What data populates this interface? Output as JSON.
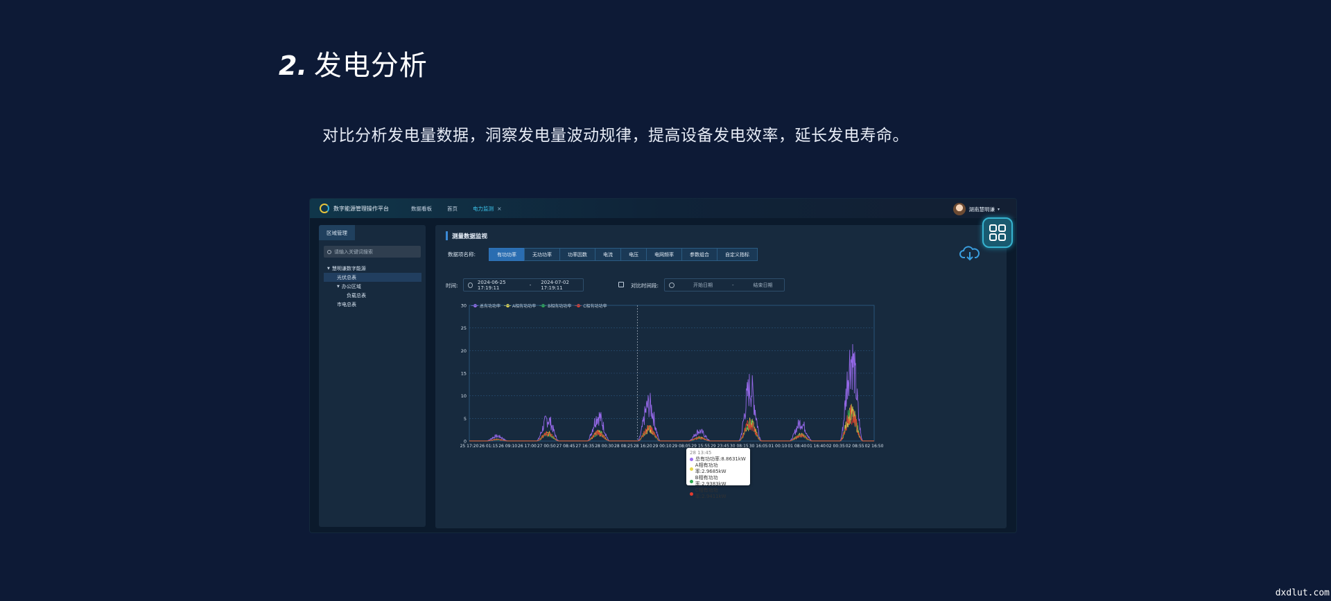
{
  "slide": {
    "number": "2.",
    "title": "发电分析",
    "description": "对比分析发电量数据，洞察发电量波动规律，提高设备发电效率，延长发电寿命。",
    "watermark": "dxdlut.com"
  },
  "app": {
    "brand": "数字能源管理操作平台",
    "nav": [
      "数据看板",
      "首页",
      "电力监测"
    ],
    "active_tab_close": "×",
    "user": "湖南慧明谦",
    "colors": {
      "accent": "#2a6db1",
      "highlight": "#3ec8f0",
      "background": "#0d1a36"
    }
  },
  "sidebar": {
    "tab": "区域管理",
    "search_placeholder": "请输入关键词搜索",
    "tree": [
      {
        "label": "慧明谦数字能源",
        "level": 1,
        "expanded": true
      },
      {
        "label": "光伏总表",
        "level": 2,
        "selected": true
      },
      {
        "label": "办公区域",
        "level": 2,
        "expanded": true
      },
      {
        "label": "负载总表",
        "level": 3
      },
      {
        "label": "市电总表",
        "level": 2
      }
    ]
  },
  "panel": {
    "title": "测量数据监视",
    "data_item_label": "数据项名称:",
    "data_tabs": [
      "有功功率",
      "无功功率",
      "功率因数",
      "电流",
      "电压",
      "电网频率",
      "参数组合",
      "自定义指标"
    ],
    "active_tab": "有功功率",
    "time_label": "时间:",
    "time_start": "2024-06-25 17:19:11",
    "time_sep": "-",
    "time_end": "2024-07-02 17:19:11",
    "compare_label": "对比时间段:",
    "compare_start_placeholder": "开始日期",
    "compare_end_placeholder": "结束日期"
  },
  "chart_data": {
    "type": "line",
    "legend_position": "top-left",
    "grid": true,
    "ylim": [
      0,
      30
    ],
    "yticks": [
      0,
      5,
      10,
      15,
      20,
      25,
      30
    ],
    "x_tick_labels": [
      "25 17:20",
      "26 01:15",
      "26 09:10",
      "26 17:00",
      "27 00:50",
      "27 08:45",
      "27 16:35",
      "28 00:30",
      "28 08:25",
      "28 16:20",
      "29 00:10",
      "29 08:05",
      "29 15:55",
      "29 23:45",
      "30 08:15",
      "30 16:05",
      "01 00:10",
      "01 08:40",
      "01 16:40",
      "02 00:35",
      "02 08:55",
      "02 16:50"
    ],
    "series": [
      {
        "name": "总有功功率",
        "color": "#9b6cf0",
        "day_peaks": [
          1.5,
          6.5,
          7.5,
          11,
          3,
          16,
          5.5,
          25
        ]
      },
      {
        "name": "A相有功功率",
        "color": "#e8d84a",
        "day_peaks": [
          0.5,
          2.2,
          2.5,
          3.7,
          1,
          5.3,
          1.8,
          8.3
        ]
      },
      {
        "name": "B相有功功率",
        "color": "#2fa84f",
        "day_peaks": [
          0.5,
          2.2,
          2.5,
          3.7,
          1,
          5.3,
          1.8,
          8.3
        ]
      },
      {
        "name": "C相有功功率",
        "color": "#e23b2e",
        "day_peaks": [
          0.5,
          2.2,
          2.5,
          3.7,
          1,
          5.3,
          1.8,
          8.3
        ]
      }
    ],
    "tooltip": {
      "title": "28 13:45",
      "rows": [
        {
          "label": "总有功功率:8.8631kW",
          "color": "#9b6cf0"
        },
        {
          "label": "A相有功功率:2.9685kW",
          "color": "#e8d84a"
        },
        {
          "label": "B相有功功率:2.9383kW",
          "color": "#2fa84f"
        },
        {
          "label": "C相有功功率:2.9411kW",
          "color": "#e23b2e"
        }
      ]
    }
  }
}
